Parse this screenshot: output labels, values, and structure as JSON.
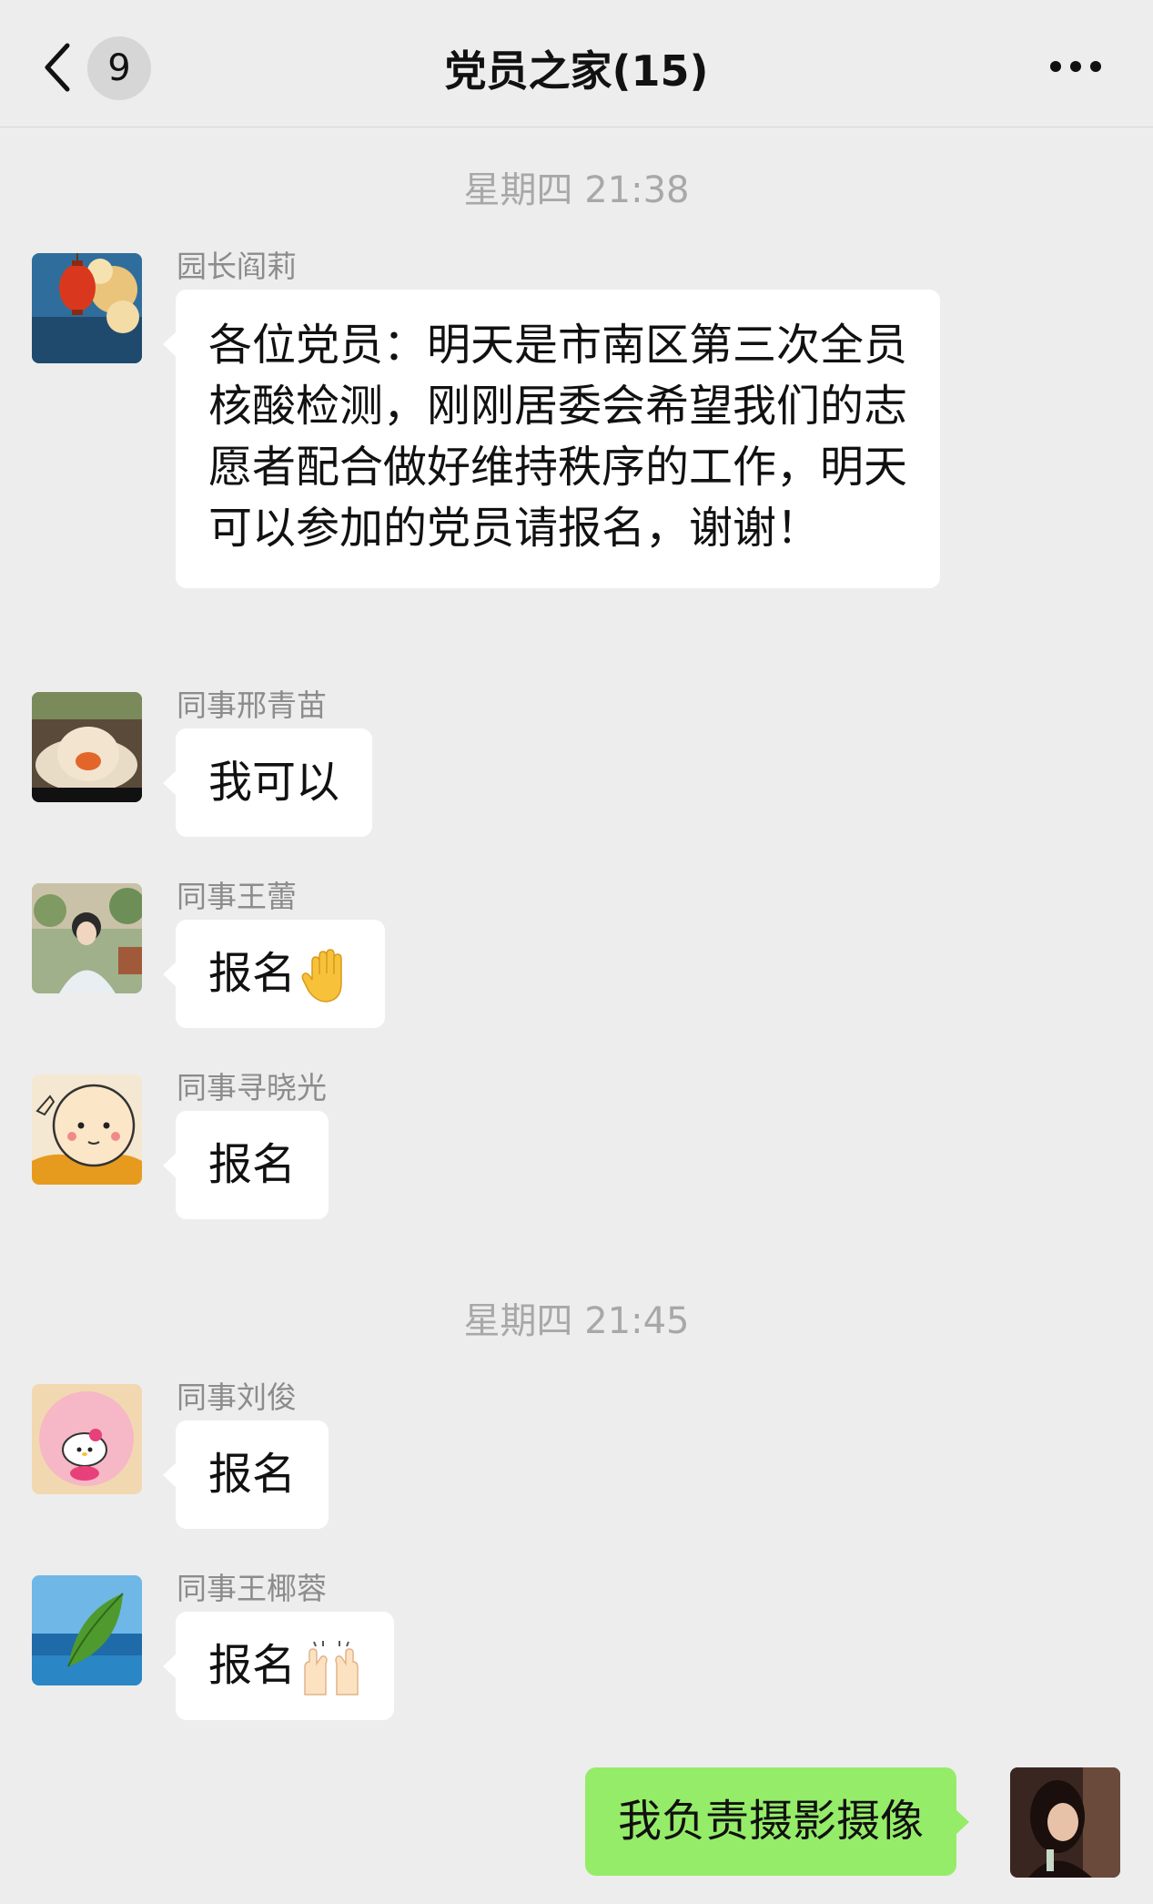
{
  "header": {
    "title": "党员之家(15)",
    "unread_badge": "9",
    "back_icon": "chevron-left-icon",
    "more_icon": "more-dots-icon"
  },
  "timestamps": [
    "星期四 21:38",
    "星期四 21:45"
  ],
  "messages": [
    {
      "sender": "园长阎莉",
      "text": "各位党员：明天是市南区第三次全员核酸检测，刚刚居委会希望我们的志愿者配合做好维持秩序的工作，明天可以参加的党员请报名，谢谢！"
    },
    {
      "sender": "同事邢青苗",
      "text": "我可以"
    },
    {
      "sender": "同事王蕾",
      "text": "报名",
      "emoji": "raised-hand-emoji"
    },
    {
      "sender": "同事寻晓光",
      "text": "报名"
    },
    {
      "sender": "同事刘俊",
      "text": "报名"
    },
    {
      "sender": "同事王椰蓉",
      "text": "报名",
      "emoji": "raising-hands-emoji"
    }
  ],
  "self_message": {
    "text": "我负责摄影摄像"
  },
  "colors": {
    "background": "#ededed",
    "bubble_other": "#ffffff",
    "bubble_self": "#95ec69",
    "timestamp_text": "#a8a8a8",
    "sender_text": "#8c8c8c"
  }
}
